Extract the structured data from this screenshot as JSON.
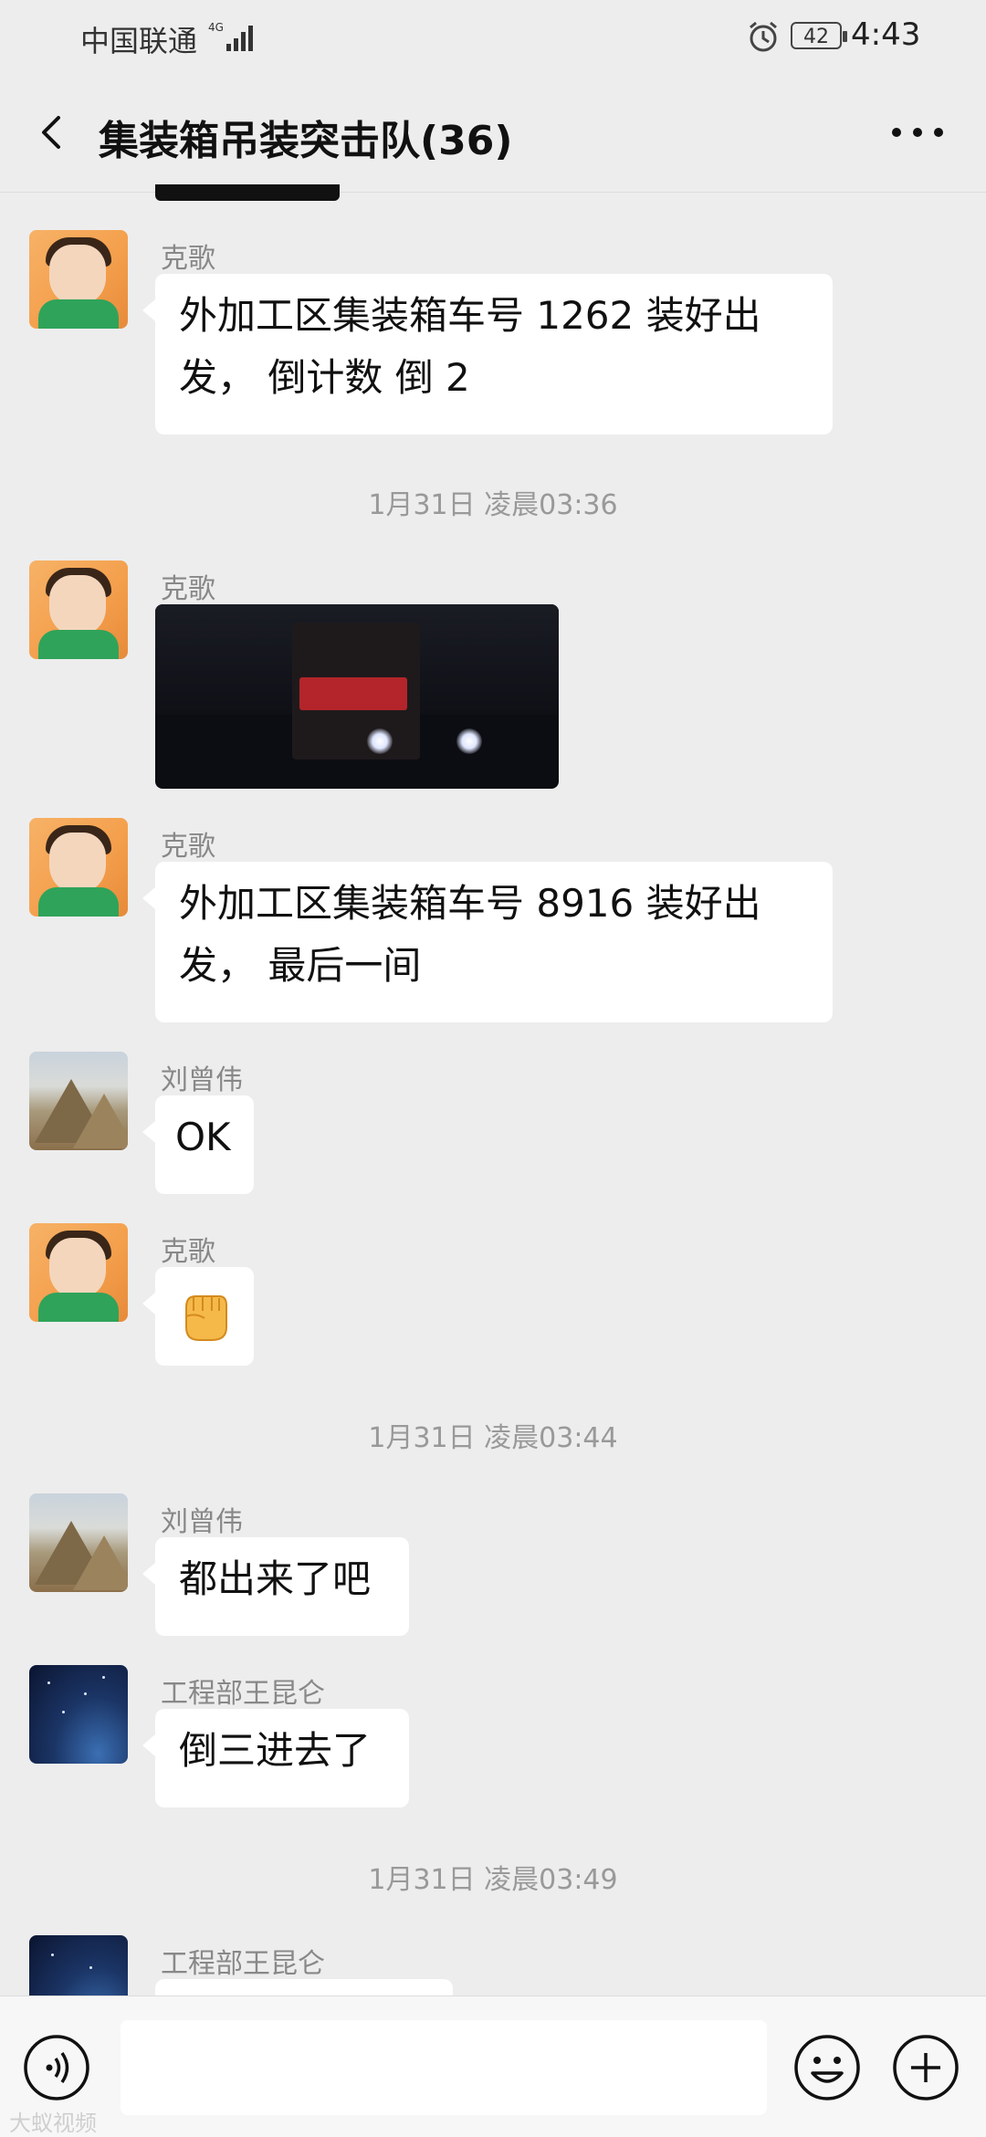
{
  "status_bar": {
    "carrier": "中国联通",
    "network": "4G",
    "battery": "42",
    "time": "4:43"
  },
  "header": {
    "title": "集装箱吊装突击队(36)"
  },
  "messages": [
    {
      "sender": "克歌",
      "text": "外加工区集装箱车号 1262 装好出发， 倒计数 倒 2"
    },
    {
      "timestamp": "1月31日 凌晨03:36"
    },
    {
      "sender": "克歌",
      "type": "image",
      "description_icon": "truck-photo"
    },
    {
      "sender": "克歌",
      "text": "外加工区集装箱车号 8916 装好出发， 最后一间"
    },
    {
      "sender": "刘曾伟",
      "text": "OK"
    },
    {
      "sender": "克歌",
      "type": "emoji",
      "icon": "fist-emoji"
    },
    {
      "timestamp": "1月31日 凌晨03:44"
    },
    {
      "sender": "刘曾伟",
      "text": "都出来了吧"
    },
    {
      "sender": "工程部王昆仑",
      "text": "倒三进去了"
    },
    {
      "timestamp": "1月31日 凌晨03:49"
    },
    {
      "sender": "工程部王昆仑",
      "text": ""
    }
  ],
  "icons": {
    "back": "back-icon",
    "more": "more-icon",
    "voice": "voice-icon",
    "emoji": "emoji-icon",
    "plus": "plus-icon"
  },
  "watermark": "大蚁视频"
}
